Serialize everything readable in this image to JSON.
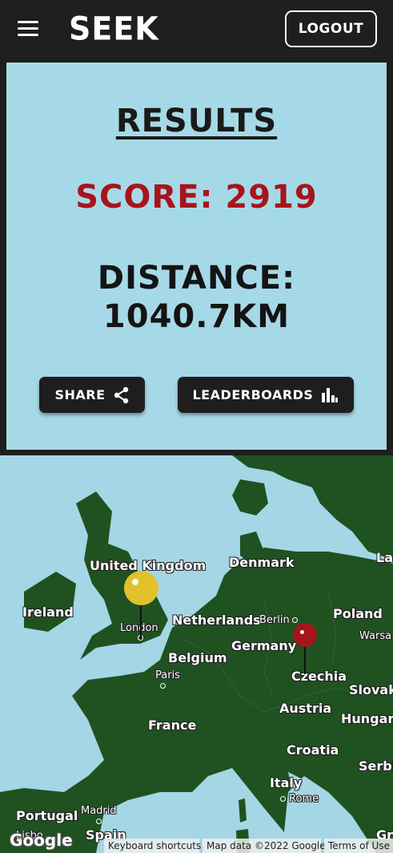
{
  "header": {
    "logo": "SEEK",
    "logout_label": "LOGOUT"
  },
  "results": {
    "title": "RESULTS",
    "score_text": "SCORE: 2919",
    "distance_line1": "DISTANCE:",
    "distance_line2": "1040.7KM",
    "share_label": "SHARE",
    "leaderboards_label": "LEADERBOARDS"
  },
  "colors": {
    "header_bg": "#1f1f1f",
    "panel_bg": "#a6d9e7",
    "score_red": "#a7141b",
    "guess_pin": "#e1c22c",
    "answer_pin": "#a7141b"
  },
  "map": {
    "labels": {
      "united_kingdom": "United Kingdom",
      "ireland": "Ireland",
      "london": "London",
      "netherlands": "Netherlands",
      "berlin": "Berlin",
      "poland": "Poland",
      "warsaw": "Warsa",
      "denmark": "Denmark",
      "germany": "Germany",
      "belgium": "Belgium",
      "paris": "Paris",
      "czechia": "Czechia",
      "slovakia": "Slovaki",
      "austria": "Austria",
      "hungary": "Hungary",
      "france": "France",
      "croatia": "Croatia",
      "serbia": "Serbi",
      "italy": "Italy",
      "rome": "Rome",
      "portugal": "Portugal",
      "madrid": "Madrid",
      "spain": "Spain",
      "lisbon": "Lisbo",
      "greece": "Gr",
      "la": "La"
    },
    "google_logo": "Google",
    "attribution": {
      "shortcuts": "Keyboard shortcuts",
      "data": "Map data ©2022 Google",
      "terms": "Terms of Use"
    }
  }
}
